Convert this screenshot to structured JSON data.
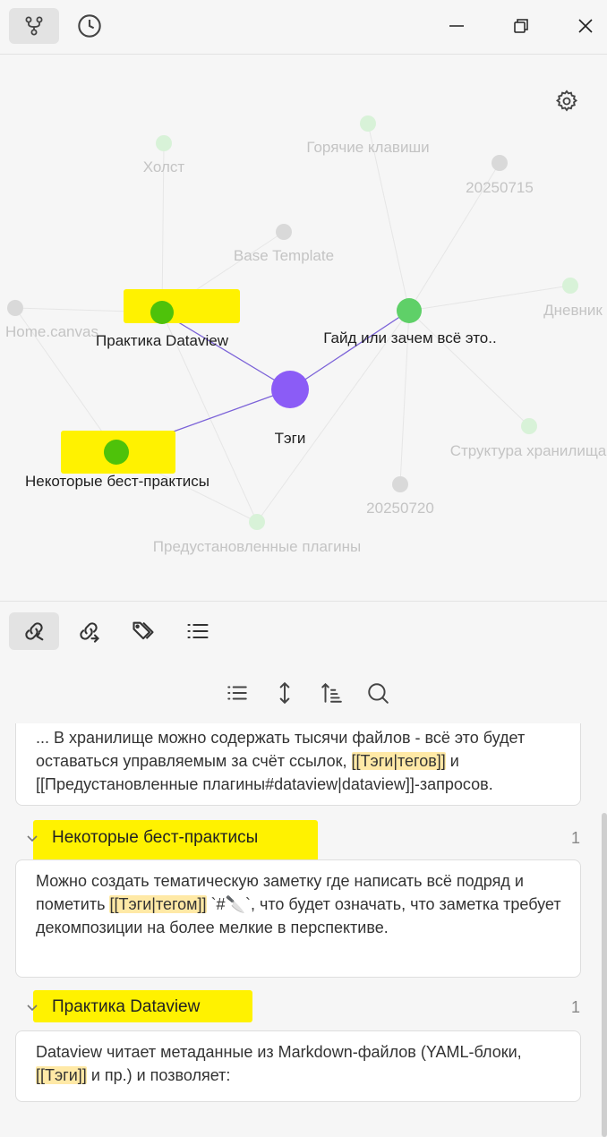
{
  "graph": {
    "nodes": [
      {
        "id": "tags",
        "label": "Тэги",
        "style": "bright"
      },
      {
        "id": "guide",
        "label": "Гайд или зачем всё это..",
        "style": "bright"
      },
      {
        "id": "dataview",
        "label": "Практика Dataview",
        "style": "bright"
      },
      {
        "id": "best",
        "label": "Некоторые бест-практисы",
        "style": "bright"
      },
      {
        "id": "hotkeys",
        "label": "Горячие клавиши",
        "style": "faded"
      },
      {
        "id": "holst",
        "label": "Холст",
        "style": "faded"
      },
      {
        "id": "d0715",
        "label": "20250715",
        "style": "faded"
      },
      {
        "id": "base",
        "label": "Base Template",
        "style": "faded"
      },
      {
        "id": "home",
        "label": "Home.canvas",
        "style": "faded"
      },
      {
        "id": "diary",
        "label": "Дневник",
        "style": "faded"
      },
      {
        "id": "structure",
        "label": "Структура хранилища",
        "style": "faded"
      },
      {
        "id": "d0720",
        "label": "20250720",
        "style": "faded"
      },
      {
        "id": "plugins",
        "label": "Предустановленные плагины",
        "style": "faded"
      }
    ],
    "colors": {
      "accent": "#8b5cf6",
      "green": "#5fd068",
      "lime": "#4ec20a",
      "faded_green": "#d8f2d8",
      "faded_gray": "#d9d9d9",
      "highlight": "#fff200"
    }
  },
  "tabs": [
    {
      "name": "backlinks",
      "icon": "link-in-icon"
    },
    {
      "name": "outgoing-links",
      "icon": "link-out-icon"
    },
    {
      "name": "tags",
      "icon": "tags-icon"
    },
    {
      "name": "outline",
      "icon": "list-icon"
    }
  ],
  "results": {
    "first_card": {
      "prefix": "...   В хранилище можно содержать тысячи файлов - всё это будет оставаться управляемым за счёт ссылок, ",
      "link": "[[Тэги|тегов]]",
      "suffix": " и [[Предустановленные плагины#dataview|dataview]]-запросов."
    },
    "groups": [
      {
        "title": "Некоторые бест-практисы",
        "count": "1",
        "text_before": "Можно создать тематическую заметку где написать всё подряд и пометить ",
        "link": "[[Тэги|тегом]]",
        "text_after": "  `#🔪`, что будет означать, что заметка требует декомпозиции на более мелкие в перспективе."
      },
      {
        "title": "Практика Dataview",
        "count": "1",
        "text_before": "Dataview читает метаданные из Markdown-файлов (YAML-блоки, ",
        "link": "[[Тэги]]",
        "text_after": " и пр.) и позволяет:"
      }
    ]
  }
}
